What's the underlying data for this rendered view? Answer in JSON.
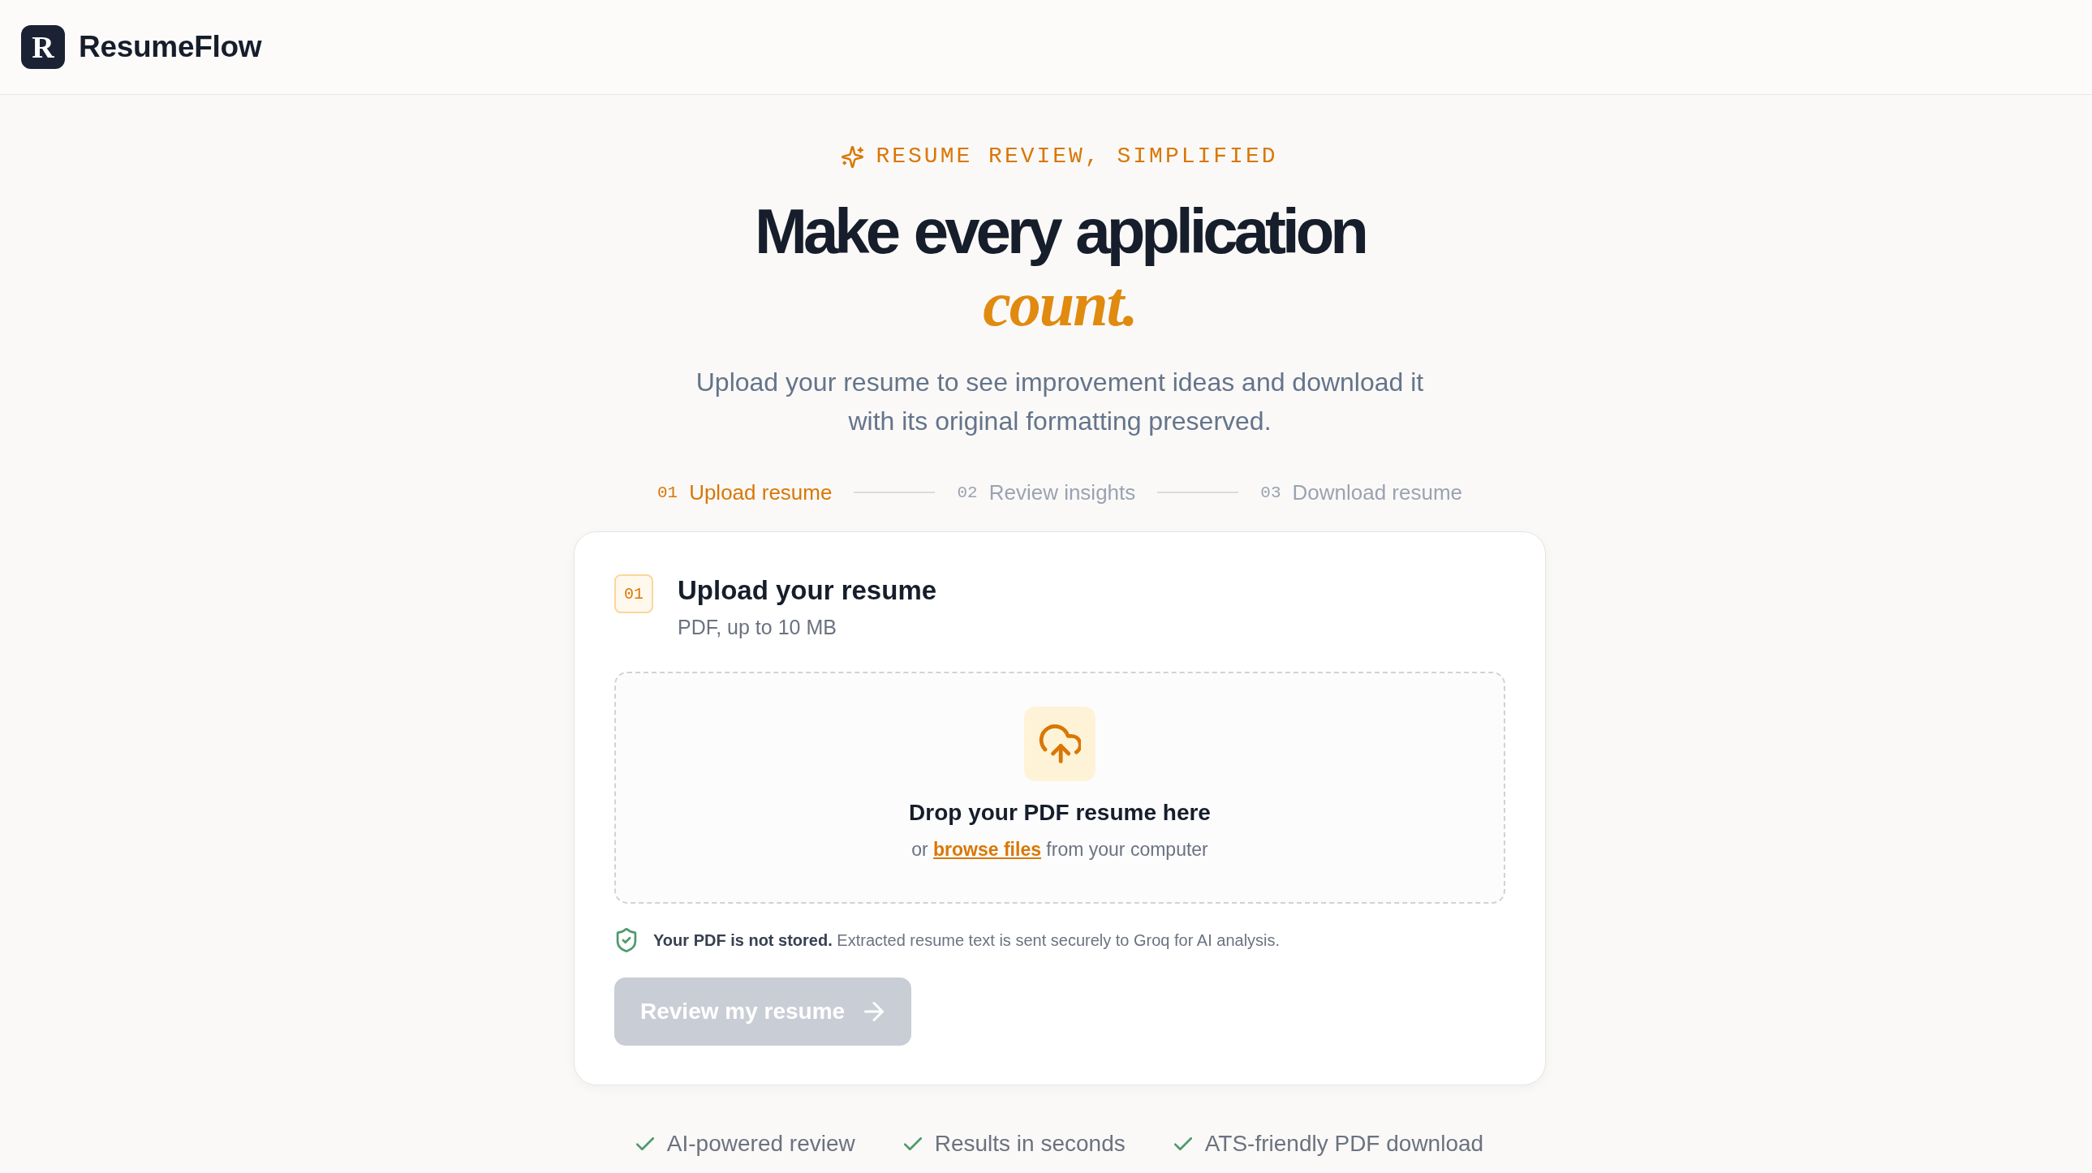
{
  "header": {
    "logo_letter": "R",
    "brand": "ResumeFlow"
  },
  "hero": {
    "eyebrow": "RESUME REVIEW, SIMPLIFIED",
    "title": "Make every application *count.*",
    "subtitle": "Upload your resume to see improvement ideas and download it with its original formatting preserved."
  },
  "steps": [
    {
      "number": "01",
      "label": "Upload resume",
      "selected": true
    },
    {
      "number": "02",
      "label": "Review insights",
      "selected": false
    },
    {
      "number": "03",
      "label": "Download resume",
      "selected": false
    }
  ],
  "card": {
    "badge": "01",
    "title": "Upload your resume",
    "subtitle": "PDF, up to 10 MB",
    "dropzone": {
      "heading": "Drop your PDF resume here",
      "prefix": "or",
      "link": "browse files",
      "suffix": "from your computer"
    },
    "note": "**Your PDF is not stored.** Extracted resume text is sent securely to Groq for AI analysis.",
    "button": {
      "label": "Review my resume",
      "disabled": true
    }
  },
  "features": [
    "AI-powered review",
    "Results in seconds",
    "ATS-friendly PDF download"
  ]
}
